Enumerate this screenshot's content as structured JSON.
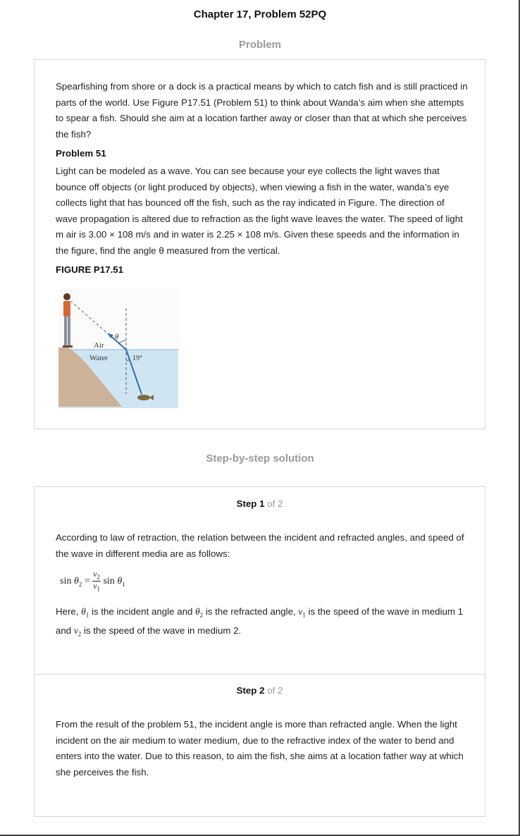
{
  "header": {
    "title": "Chapter 17, Problem 52PQ"
  },
  "problem": {
    "heading": "Problem",
    "intro": "Spearfishing from shore or a dock is a practical means by which to catch fish and is still practiced in parts of the world. Use Figure P17.51 (Problem 51) to think about Wanda’s aim when she attempts to spear a fish. Should she aim at a location farther away or closer than that at which she perceives the fish?",
    "subheading": "Problem 51",
    "body": "Light can be modeled as a wave. You can see because your eye collects the light waves that bounce off objects (or light produced by objects), when viewing a fish in the water, wanda’s eye collects light that has bounced off the fish, such as the ray indicated in Figure. The direction of wave propagation is altered due to refraction as the light wave leaves the water. The speed of light m air is 3.00 × 108 m/s and in water is 2.25 × 108 m/s. Given these speeds and the information in the figure, find the angle θ measured from the vertical.",
    "figure_label": "FIGURE P17.51",
    "figure": {
      "air_label": "Air",
      "water_label": "Water",
      "theta_label": "θ",
      "angle_label": "19°"
    }
  },
  "solution": {
    "heading": "Step-by-step solution",
    "steps": [
      {
        "step_word": "Step",
        "number": "1",
        "of_total": "of 2",
        "text": "According to law of retraction, the relation between the incident and refracted angles, and speed of the wave in different media are as follows:",
        "formula": {
          "lhs_fn": "sin",
          "lhs_var": "θ",
          "lhs_sub": "2",
          "eq": "=",
          "num_var": "v",
          "num_sub": "2",
          "den_var": "v",
          "den_sub": "1",
          "rhs_fn": "sin",
          "rhs_var": "θ",
          "rhs_sub": "1"
        },
        "here": {
          "t1": "Here,",
          "t2": "is the incident angle and",
          "t3": "is the refracted angle,",
          "t4": "is the speed of the wave in medium 1 and",
          "t5": "is the speed of the wave in medium 2.",
          "sym_theta": "θ",
          "sym_v": "v",
          "sub1": "1",
          "sub2": "2"
        }
      },
      {
        "step_word": "Step",
        "number": "2",
        "of_total": "of 2",
        "text": "From the result of the problem 51, the incident angle is more than refracted angle. When the light incident on the air medium to water medium, due to the refractive index of the water to bend and enters into the water. Due to this reason, to aim the fish, she aims at a location father way at which she perceives the fish."
      }
    ]
  },
  "colors": {
    "ray": "#2f6fb0",
    "water": "#cfe6f2",
    "shore": "#cdb29a",
    "muted": "#999999"
  }
}
